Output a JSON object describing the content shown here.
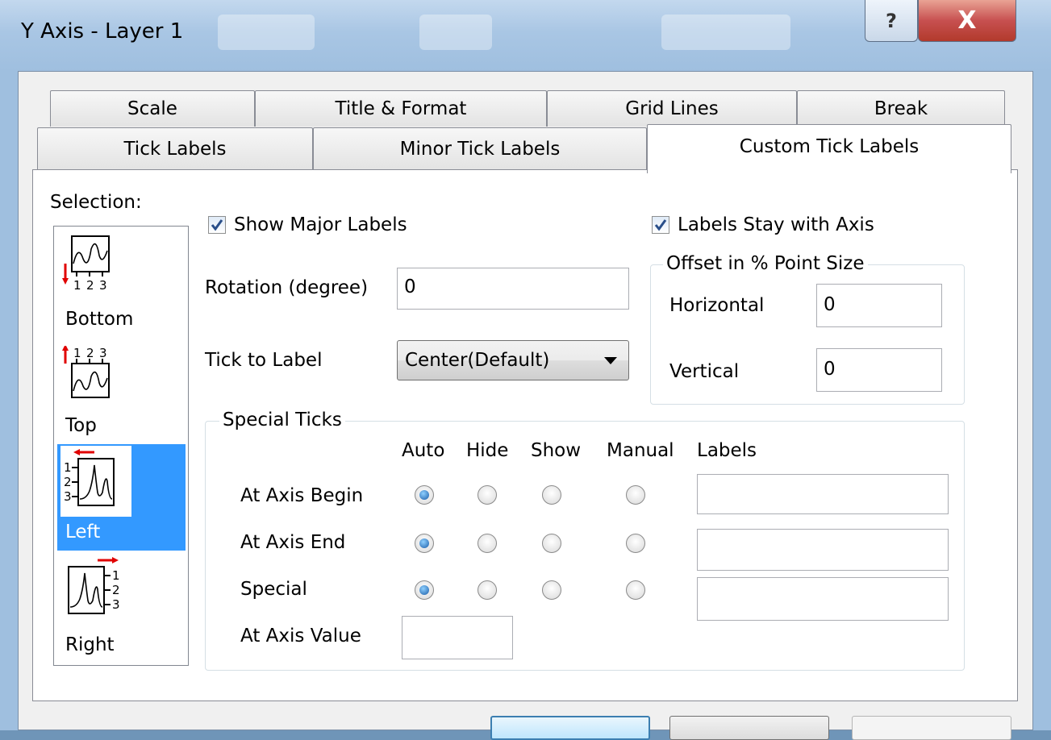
{
  "window": {
    "title": "Y Axis - Layer 1",
    "help_glyph": "?",
    "close_glyph": "X"
  },
  "tabs": {
    "row_back": [
      "Scale",
      "Title & Format",
      "Grid Lines",
      "Break"
    ],
    "row_front": [
      "Tick Labels",
      "Minor Tick Labels",
      "Custom Tick Labels"
    ],
    "active": "Custom Tick Labels"
  },
  "selection": {
    "label": "Selection:",
    "items": [
      {
        "label": "Bottom",
        "ticks": [
          "1",
          "2",
          "3"
        ]
      },
      {
        "label": "Top",
        "ticks": [
          "1",
          "2",
          "3"
        ]
      },
      {
        "label": "Left",
        "ticks": [
          "1",
          "2",
          "3"
        ]
      },
      {
        "label": "Right",
        "ticks": [
          "1",
          "2",
          "3"
        ]
      }
    ],
    "selected": "Left"
  },
  "show_major_labels": {
    "label": "Show Major Labels",
    "checked": true
  },
  "labels_stay_with_axis": {
    "label": "Labels Stay with Axis",
    "checked": true
  },
  "rotation": {
    "label": "Rotation (degree)",
    "value": "0"
  },
  "tick_to_label": {
    "label": "Tick to Label",
    "value": "Center(Default)"
  },
  "offset": {
    "title": "Offset in % Point Size",
    "horizontal_label": "Horizontal",
    "horizontal_value": "0",
    "vertical_label": "Vertical",
    "vertical_value": "0"
  },
  "special_ticks": {
    "title": "Special Ticks",
    "columns": [
      "Auto",
      "Hide",
      "Show",
      "Manual",
      "Labels"
    ],
    "rows": [
      {
        "label": "At Axis Begin",
        "selected": "Auto",
        "labels_value": ""
      },
      {
        "label": "At Axis End",
        "selected": "Auto",
        "labels_value": ""
      },
      {
        "label": "Special",
        "selected": "Auto",
        "labels_value": ""
      }
    ],
    "axis_value_label": "At Axis Value",
    "axis_value": ""
  },
  "colors": {
    "selection_highlight": "#3399ff",
    "marker_red": "#e00000",
    "check_blue": "#2a4f8a"
  }
}
